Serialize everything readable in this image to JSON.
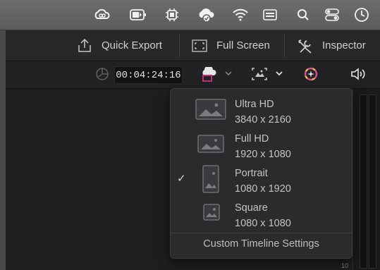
{
  "menubar": {
    "icons": [
      "creative-cloud-icon",
      "battery-icon",
      "gpu-icon",
      "cloud-sync-icon",
      "wifi-icon",
      "keyboard-input-icon",
      "search-icon",
      "control-center-icon",
      "clock-icon"
    ]
  },
  "toolbar": {
    "quick_export": "Quick Export",
    "full_screen": "Full Screen",
    "inspector": "Inspector"
  },
  "viewer": {
    "timecode": "00:04:24:16",
    "meter_tick": "10"
  },
  "dropdown": {
    "options": [
      {
        "name": "Ultra HD",
        "dims": "3840 x 2160",
        "selected": false
      },
      {
        "name": "Full HD",
        "dims": "1920 x 1080",
        "selected": false
      },
      {
        "name": "Portrait",
        "dims": "1080 x 1920",
        "selected": true
      },
      {
        "name": "Square",
        "dims": "1080 x 1080",
        "selected": false
      }
    ],
    "check_mark": "✓",
    "custom_label": "Custom Timeline Settings"
  },
  "colors": {
    "accent_magenta": "#c0307a",
    "panel": "#2b2b2e"
  }
}
